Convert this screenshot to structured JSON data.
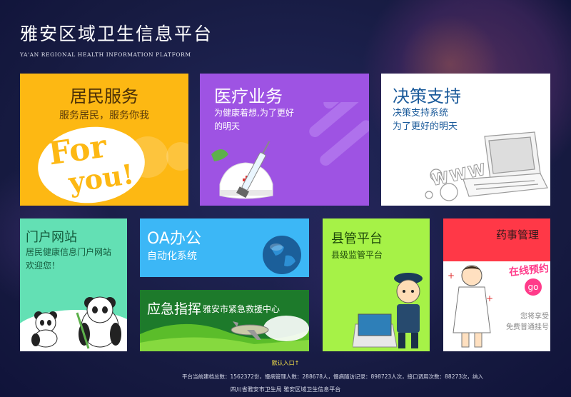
{
  "header": {
    "title": "雅安区域卫生信息平台",
    "subtitle": "YA'AN REGIONAL HEALTH INFORMATION PLATFORM"
  },
  "tiles": {
    "resident": {
      "title": "居民服务",
      "subtitle": "服务居民，服务你我",
      "art_text_1": "For",
      "art_text_2": "you!",
      "color": "#fdb813"
    },
    "medical": {
      "title": "医疗业务",
      "subtitle": "为健康着想,为了更好\n的明天",
      "color": "#9e53e3"
    },
    "decision": {
      "title": "决策支持",
      "subtitle": "决策支持系统\n为了更好的明天",
      "art_text": "WWW",
      "color": "#ffffff"
    },
    "portal": {
      "title": "门户网站",
      "subtitle": "居民健康信息门户网站\n欢迎您！",
      "color": "#63e0b4"
    },
    "oa": {
      "title": "OA办公",
      "subtitle": "自动化系统",
      "color": "#3cb7f6"
    },
    "emergency": {
      "title": "应急指挥",
      "subtitle": "雅安市紧急救援中心",
      "color": "#1d7a2b"
    },
    "county": {
      "title": "县管平台",
      "subtitle": "县级监管平台",
      "color": "#a6f247"
    },
    "pharmacy": {
      "title": "药事管理",
      "banner": "在线预约",
      "go_label": "go",
      "caption": "您将享受\n免费普通挂号",
      "color": "#ff3847"
    }
  },
  "footer": {
    "entry_link": "默认入口",
    "stats": "平台当前建档总数：1562372份，慢病管理人数：288678人，慢病随访记录：898723人次，接口调用次数：88273次，纳入",
    "copyright": "四川省雅安市卫生局 雅安区域卫生信息平台",
    "link_color": "#f5e04a"
  }
}
